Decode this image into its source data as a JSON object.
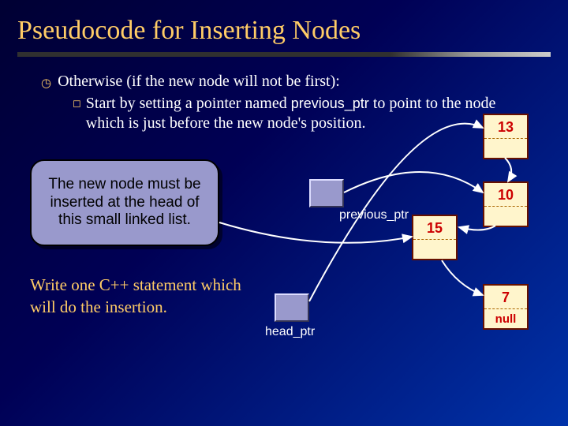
{
  "slide": {
    "title": "Pseudocode for Inserting Nodes",
    "bullet1": "Otherwise (if the new node will not be first):",
    "bullet2_pre": "Start by setting a pointer named ",
    "bullet2_code": "previous_ptr",
    "bullet2_post": " to point to the node which is just before the new node's position.",
    "callout": "The new node must be inserted at the head of this small linked list.",
    "statement": "Write one C++ statement which will do the insertion."
  },
  "pointers": {
    "previous_ptr_label": "previous_ptr",
    "head_ptr_label": "head_ptr"
  },
  "nodes": {
    "n1": "13",
    "n2": "10",
    "n3": "15",
    "n4": "7",
    "null_label": "null"
  }
}
